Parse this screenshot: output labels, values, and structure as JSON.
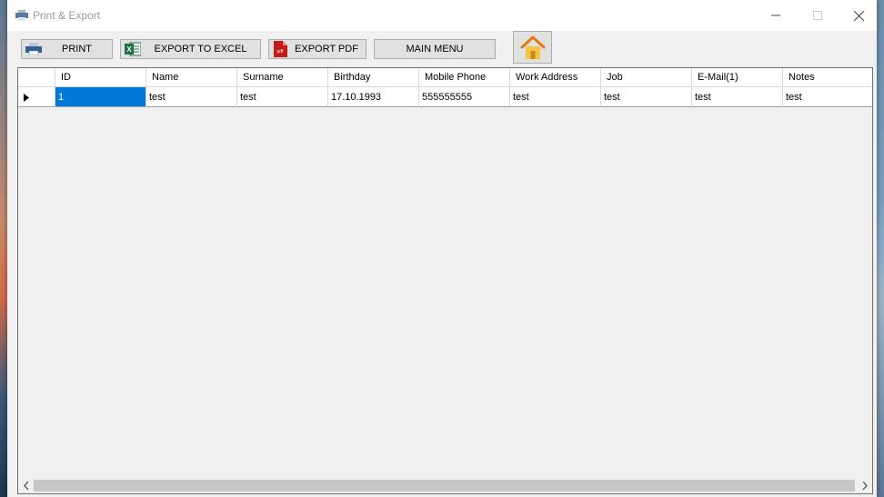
{
  "window": {
    "title": "Print & Export"
  },
  "toolbar": {
    "print": "PRINT",
    "excel": "EXPORT TO EXCEL",
    "pdf": "EXPORT PDF",
    "main_menu": "MAIN MENU"
  },
  "grid": {
    "columns": [
      "ID",
      "Name",
      "Surname",
      "Birthday",
      "Mobile Phone",
      "Work Address",
      "Job",
      "E-Mail(1)",
      "Notes"
    ],
    "rows": [
      [
        "1",
        "test",
        "test",
        "17.10.1993",
        "555555555",
        "test",
        "test",
        "test",
        "test"
      ]
    ]
  },
  "icons": {
    "print": "printer-icon",
    "excel": "excel-icon",
    "pdf": "pdf-icon",
    "home": "home-icon"
  }
}
